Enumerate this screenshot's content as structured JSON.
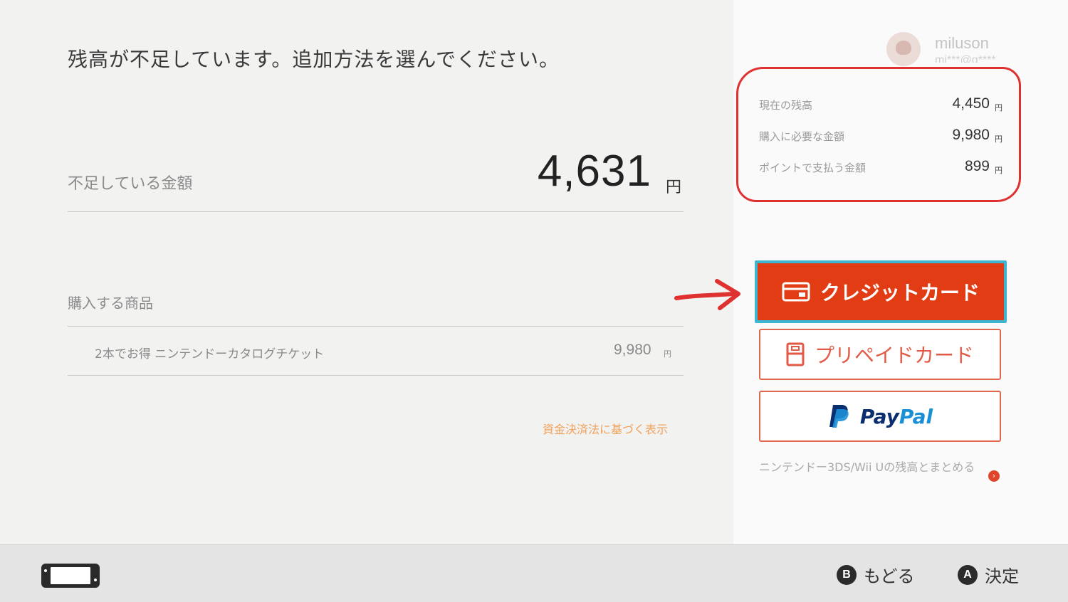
{
  "header": {
    "message": "残高が不足しています。追加方法を選んでください。"
  },
  "shortfall": {
    "label": "不足している金額",
    "value": "4,631",
    "unit": "円"
  },
  "purchase": {
    "label": "購入する商品",
    "items": [
      {
        "name": "2本でお得 ニンテンドーカタログチケット",
        "price": "9,980",
        "unit": "円"
      }
    ],
    "legal_link": "資金決済法に基づく表示"
  },
  "user": {
    "name": "miluson",
    "id": "mi***@g****"
  },
  "summary": [
    {
      "label": "現在の残高",
      "value": "4,450",
      "unit": "円"
    },
    {
      "label": "購入に必要な金額",
      "value": "9,980",
      "unit": "円"
    },
    {
      "label": "ポイントで支払う金額",
      "value": "899",
      "unit": "円"
    }
  ],
  "payment_options": {
    "credit": "クレジットカード",
    "prepaid": "プリペイドカード",
    "paypal_a": "Pay",
    "paypal_b": "Pal"
  },
  "merge_link": "ニンテンドー3DS/Wii Uの残高とまとめる",
  "footer": {
    "back": {
      "key": "B",
      "label": "もどる"
    },
    "confirm": {
      "key": "A",
      "label": "決定"
    }
  },
  "colors": {
    "accent_red": "#e23c14",
    "focus_cyan": "#3fb6cf",
    "annotation_red": "#e03131",
    "paypal_dark": "#0b2e6f",
    "paypal_light": "#1a8fd6"
  }
}
